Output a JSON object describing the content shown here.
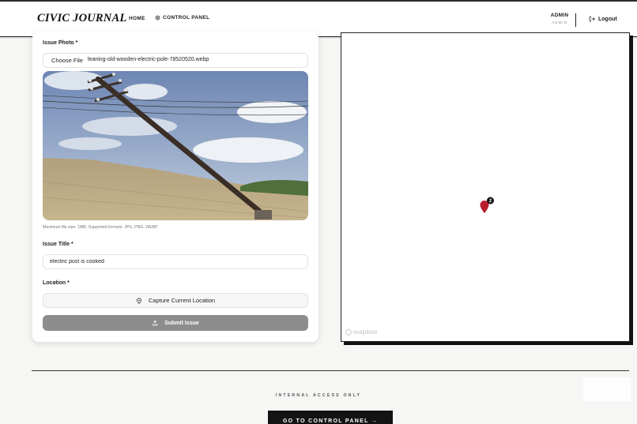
{
  "header": {
    "logo": "CIVIC JOURNAL",
    "nav_home": "HOME",
    "nav_control_panel": "CONTROL PANEL",
    "user_name": "ADMIN",
    "user_role": "ADMIN",
    "logout": "Logout"
  },
  "form": {
    "photo_label": "Issue Photo *",
    "choose_file": "Choose File",
    "file_name": "leaning-old-wooden-electric-pole-78520520.webp",
    "hint": "Maximum file size: 1MB. Supported formats: JPG, PNG, WEBP",
    "title_label": "Issue Title *",
    "title_value": "electric post is cooked",
    "location_label": "Location *",
    "capture_location": "Capture Current Location",
    "submit": "Submit Issue"
  },
  "map": {
    "marker_count": "2",
    "attribution": "mapbox"
  },
  "footer": {
    "internal": "INTERNAL ACCESS ONLY",
    "goto_button": "GO TO CONTROL PANEL →"
  },
  "colors": {
    "accent_dark": "#131313",
    "submit_disabled": "#8d8d8d",
    "marker": "#b81d2c"
  },
  "icons": [
    "settings-icon",
    "logout-icon",
    "location-pin-icon",
    "upload-icon",
    "map-marker-icon",
    "mapbox-logo-icon"
  ]
}
